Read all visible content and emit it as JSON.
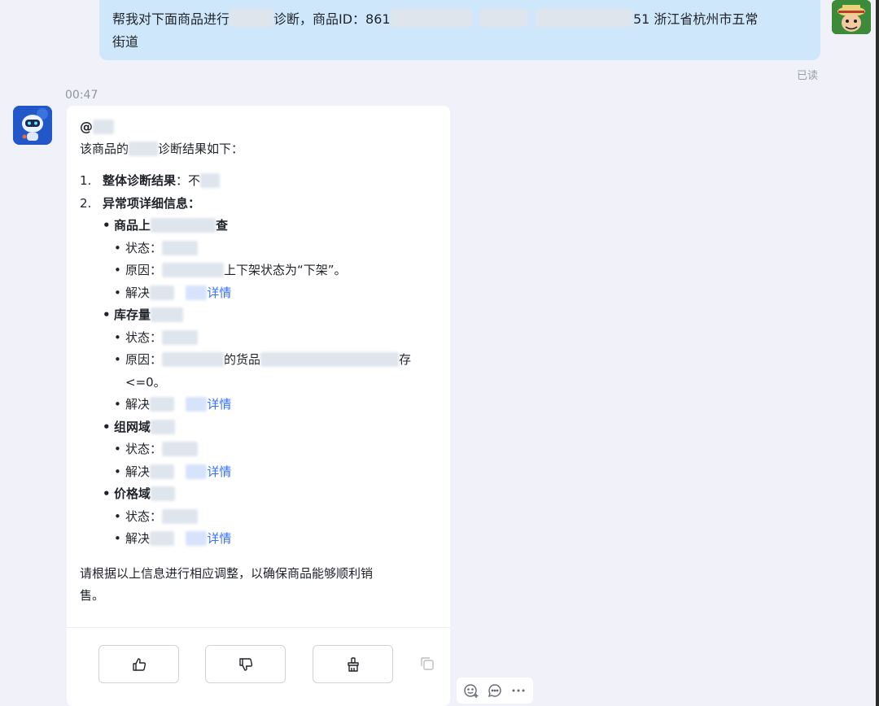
{
  "outgoing": {
    "line1_a": "帮我对下面商品进行",
    "line1_b": "诊断，商品ID：861",
    "line1_c": "51 浙江省杭州市五常",
    "line2": "街道",
    "read_status": "已读"
  },
  "timestamp": "00:47",
  "bot_message": {
    "mention": "@",
    "intro_a": "该商品的",
    "intro_b": "诊断结果如下：",
    "items": [
      {
        "num": "1.",
        "label": "整体诊断结果",
        "sep": "：",
        "value": "不"
      },
      {
        "num": "2.",
        "label": "异常项详细信息：",
        "sep": "",
        "value": ""
      }
    ],
    "groups": [
      {
        "title_a": "商品上",
        "title_b": "查",
        "status_label": "状态：",
        "reason_label": "原因：",
        "reason_text": "上下架状态为“下架”。",
        "solution_label": "解决",
        "detail_link": "详情"
      },
      {
        "title_a": "库存量",
        "status_label": "状态：",
        "reason_label": "原因：",
        "reason_text_a": "的货品",
        "reason_text_b": "存",
        "reason_text_c": "<=0。",
        "solution_label": "解决",
        "detail_link": "详情"
      },
      {
        "title_a": "组网域",
        "status_label": "状态：",
        "solution_label": "解决",
        "detail_link": "详情"
      },
      {
        "title_a": "价格域",
        "status_label": "状态：",
        "solution_label": "解决",
        "detail_link": "详情"
      }
    ],
    "closing_line1": "请根据以上信息进行相应调整，以确保商品能够顺利销",
    "closing_line2": "售。"
  },
  "feedback_buttons": {
    "like_icon": "thumbs-up-icon",
    "dislike_icon": "thumbs-down-icon",
    "clean_icon": "broom-icon",
    "copy_icon": "copy-icon"
  },
  "reaction_bar": {
    "icons": [
      "emoji-add-icon",
      "reply-bubble-icon",
      "more-icon"
    ]
  },
  "colors": {
    "background": "#f1f2f9",
    "outgoing_bubble": "#cfe7fb",
    "link": "#3370ff",
    "card": "#ffffff"
  }
}
